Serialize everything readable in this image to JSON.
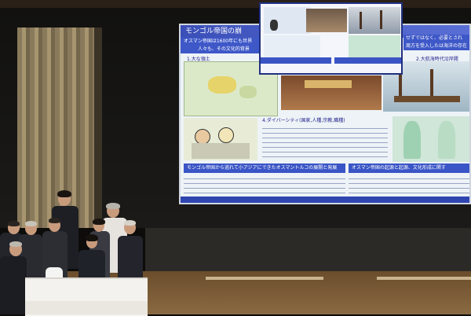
{
  "slide": {
    "title": "モンゴル帝国の崩",
    "intro": "オスマン帝国は1600年にも世界",
    "intro2": "人々も、その文化的背景",
    "right_intro": "せずではなく、必要とされ",
    "right_intro2": "周方を受入したは海洋の存在",
    "section1": "1.大な領土",
    "section2": "2.大航海時代沿岸開",
    "section3": "4.ダイバーシティ(国家,人種,宗教,職種)",
    "bottom_left": "モンゴル帝国から逃れて小アジアにできたオスマントルコの展開と発展",
    "bottom_right": "オスマン帝国の起源と起源、文化形成に関す"
  },
  "inset": {
    "caption_left": "",
    "caption_right": ""
  }
}
